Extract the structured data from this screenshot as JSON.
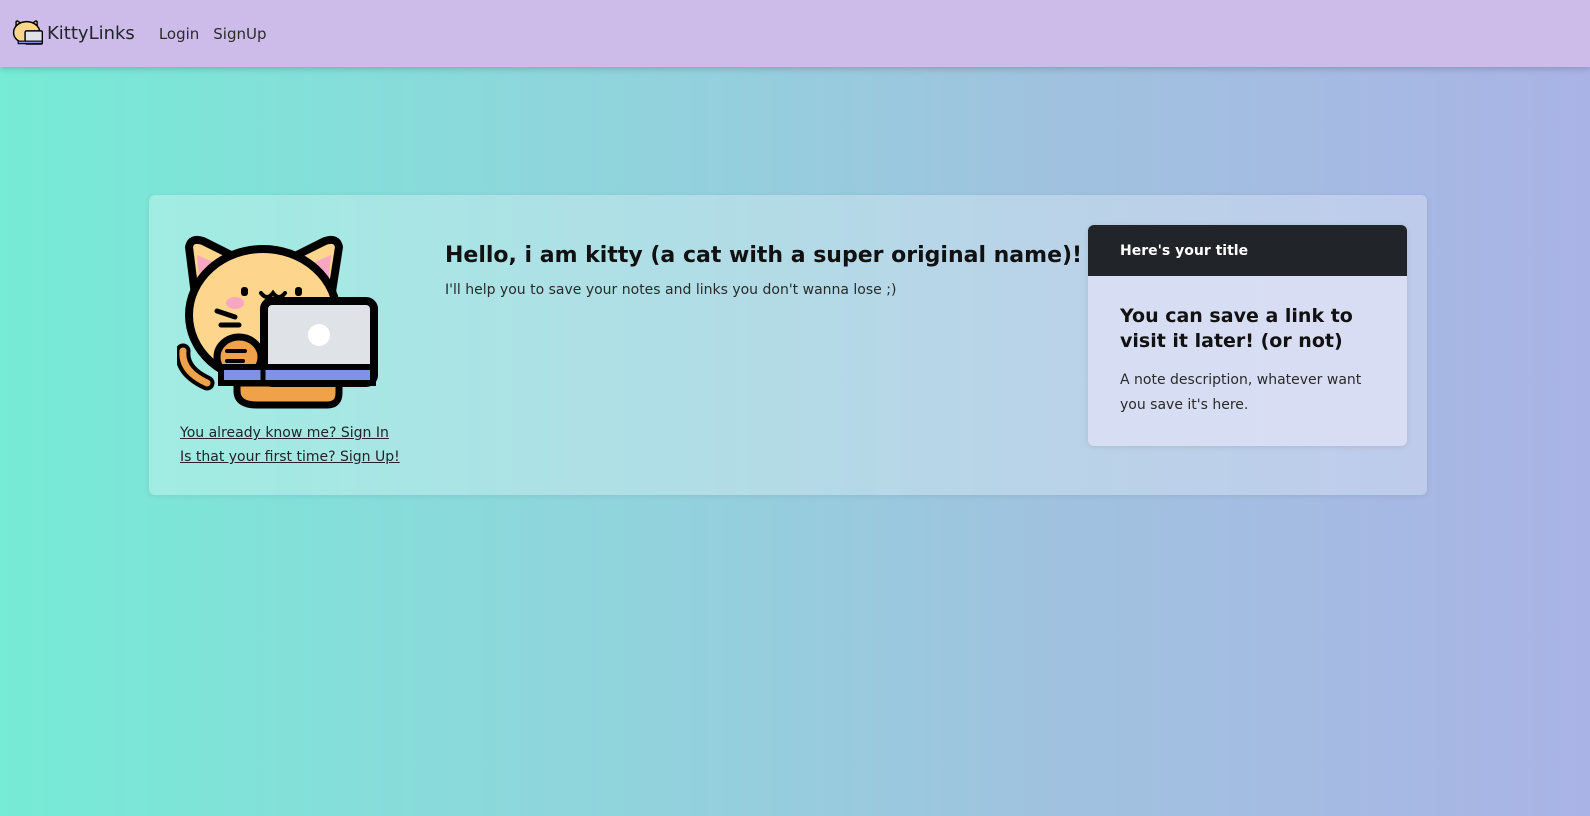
{
  "navbar": {
    "brand": "KittyLinks",
    "logo_icon": "cat-laptop-icon",
    "links": [
      "Login",
      "SignUp"
    ]
  },
  "hero": {
    "illustration_icon": "cat-laptop-illustration",
    "title": "Hello, i am kitty (a cat with a super original name)!",
    "subtitle": "I'll help you to save your notes and links you don't wanna lose ;)",
    "signin_link": "You already know me? Sign In",
    "signup_link": "Is that your first time? Sign Up!"
  },
  "note_card": {
    "header": "Here's your title",
    "title": "You can save a link to visit it later! (or not)",
    "description": "A note description, whatever want you save it's here."
  },
  "colors": {
    "navbar": "#cdbbe9",
    "gradient_start": "#76ebd6",
    "gradient_end": "#aab3e6",
    "card_header": "#212428",
    "cat_fur": "#fdd58c",
    "cat_stripes": "#f0a24b",
    "laptop_screen": "#dfe3e8",
    "laptop_base": "#7f93e6"
  }
}
